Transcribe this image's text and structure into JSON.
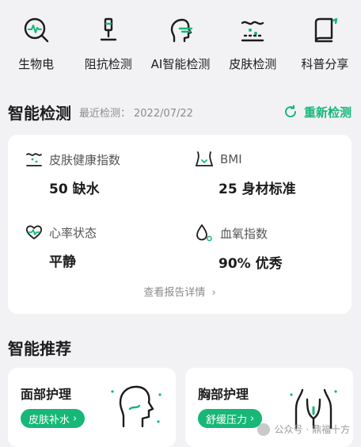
{
  "quick_nav": [
    {
      "label": "生物电",
      "icon": "bioelectric-icon"
    },
    {
      "label": "阻抗检测",
      "icon": "impedance-probe-icon"
    },
    {
      "label": "AI智能检测",
      "icon": "ai-face-scan-icon"
    },
    {
      "label": "皮肤检测",
      "icon": "skin-layers-icon"
    },
    {
      "label": "科普分享",
      "icon": "book-icon"
    }
  ],
  "smart_check": {
    "title": "智能检测",
    "last_label": "最近检测：",
    "last_date": "2022/07/22",
    "rescan_label": "重新检测",
    "metrics": [
      {
        "label": "皮肤健康指数",
        "value": "50 缺水",
        "icon": "skin-health-icon"
      },
      {
        "label": "BMI",
        "value": "25 身材标准",
        "icon": "body-shape-icon"
      },
      {
        "label": "心率状态",
        "value": "平静",
        "icon": "heart-rate-icon"
      },
      {
        "label": "血氧指数",
        "value": "90% 优秀",
        "icon": "blood-oxygen-icon"
      }
    ],
    "report_link": "查看报告详情"
  },
  "recommend": {
    "title": "智能推荐",
    "items": [
      {
        "title": "面部护理",
        "tag": "皮肤补水"
      },
      {
        "title": "胸部护理",
        "tag": "舒缓压力"
      }
    ]
  },
  "watermark": "公众号 · 鼎福十方",
  "colors": {
    "accent": "#17b777",
    "background": "#f2f2f4",
    "card": "#ffffff"
  }
}
